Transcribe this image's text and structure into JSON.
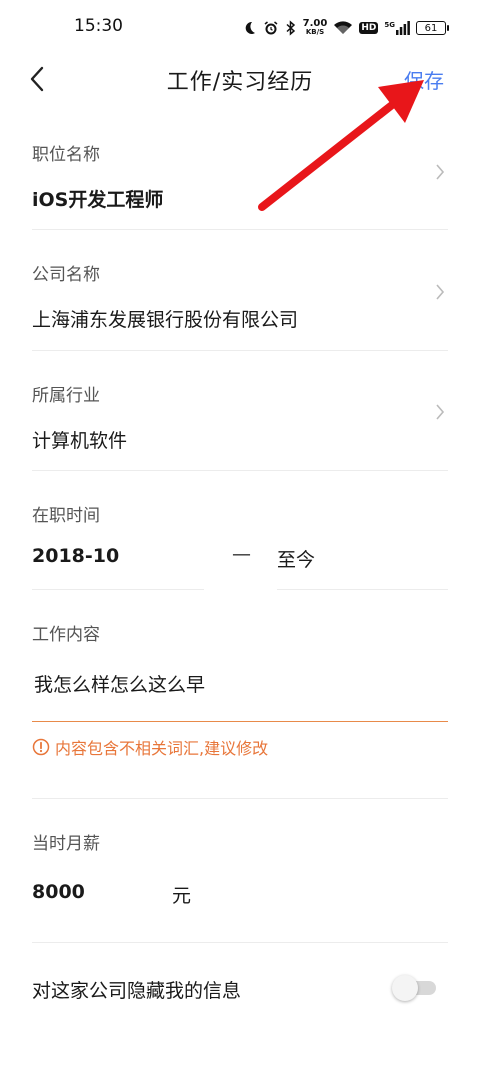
{
  "status_bar": {
    "time": "15:30",
    "net_speed": "7.00",
    "net_speed_unit": "KB/S",
    "hd": "HD",
    "network": "5G",
    "battery": "61"
  },
  "nav": {
    "title": "工作/实习经历",
    "save_label": "保存",
    "save_color": "#4a7df0"
  },
  "form": {
    "position": {
      "label": "职位名称",
      "value": "iOS开发工程师"
    },
    "company": {
      "label": "公司名称",
      "value": "上海浦东发展银行股份有限公司"
    },
    "industry": {
      "label": "所属行业",
      "value": "计算机软件"
    },
    "tenure": {
      "label": "在职时间",
      "start": "2018-10",
      "separator": "—",
      "end": "至今"
    },
    "content": {
      "label": "工作内容",
      "value": "我怎么样怎么这么早",
      "warning": "内容包含不相关词汇,建议修改",
      "warning_color": "#e8763a"
    },
    "salary": {
      "label": "当时月薪",
      "value": "8000",
      "unit": "元"
    },
    "hide_info": {
      "label": "对这家公司隐藏我的信息",
      "enabled": false
    }
  },
  "annotation": {
    "arrow_color": "#e8161a"
  }
}
